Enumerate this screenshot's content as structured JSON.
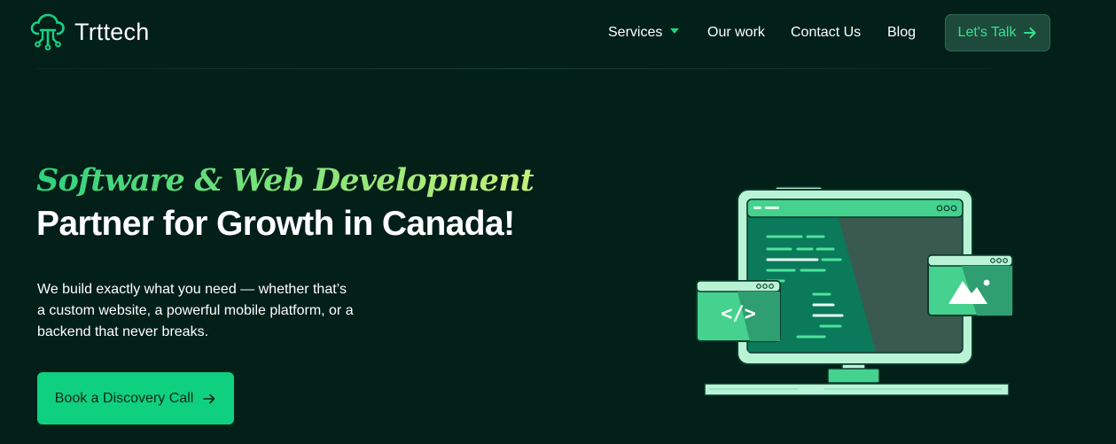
{
  "brand": {
    "name": "Trttech",
    "accent": "#0fd07e",
    "background": "#021f18"
  },
  "nav": {
    "items": [
      {
        "label": "Services",
        "has_dropdown": true
      },
      {
        "label": "Our work"
      },
      {
        "label": "Contact Us"
      },
      {
        "label": "Blog"
      }
    ],
    "cta_label": "Let's Talk",
    "cta_icon": "arrow-right-icon"
  },
  "hero": {
    "tagline": "Software & Web Development",
    "headline": "Partner for Growth in Canada!",
    "description_lines": [
      "We build exactly what you need — whether that’s",
      "a custom website, a powerful mobile platform, or a",
      "backend that never breaks."
    ],
    "cta_label": "Book a Discovery Call",
    "cta_icon": "arrow-right-icon"
  },
  "illustration": {
    "code_symbol": "</>",
    "icons": [
      "monitor-icon",
      "code-window-icon",
      "image-window-icon"
    ]
  }
}
